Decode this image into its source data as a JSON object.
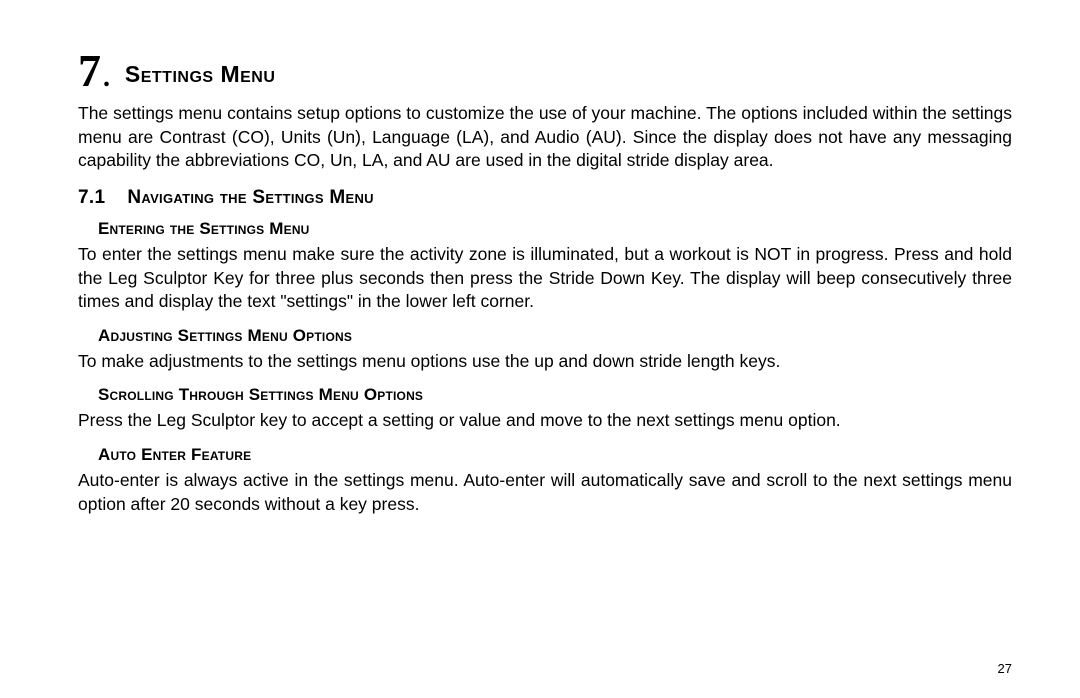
{
  "chapter": {
    "number": "7",
    "title": "Settings Menu"
  },
  "intro": "The settings menu contains setup options to customize the use of your machine.  The options included within the settings menu are Contrast (CO), Units (Un), Language (LA), and Audio (AU).  Since the display does not have any messaging capability the abbreviations CO, Un, LA, and AU are used in the digital stride display area.",
  "section": {
    "number": "7.1",
    "title": "Navigating the Settings Menu"
  },
  "sub1": {
    "title": "Entering the Settings Menu",
    "body": "To enter the settings menu make sure the activity zone is illuminated, but a workout is NOT in progress.  Press and hold the Leg Sculptor Key for three plus seconds then press the Stride Down Key. The display will beep consecutively three times and display the text \"settings\" in the lower left corner."
  },
  "sub2": {
    "title": "Adjusting Settings Menu Options",
    "body": "To make adjustments to the settings menu options use the up and down stride length keys."
  },
  "sub3": {
    "title": "Scrolling Through Settings Menu Options",
    "body": "Press the Leg Sculptor key to accept a setting or value and move to the next settings menu option."
  },
  "sub4": {
    "title": "Auto Enter Feature",
    "body": "Auto-enter is always active in the settings menu.  Auto-enter will automatically save and scroll to the next settings menu option after 20 seconds without a key press."
  },
  "pageNumber": "27"
}
